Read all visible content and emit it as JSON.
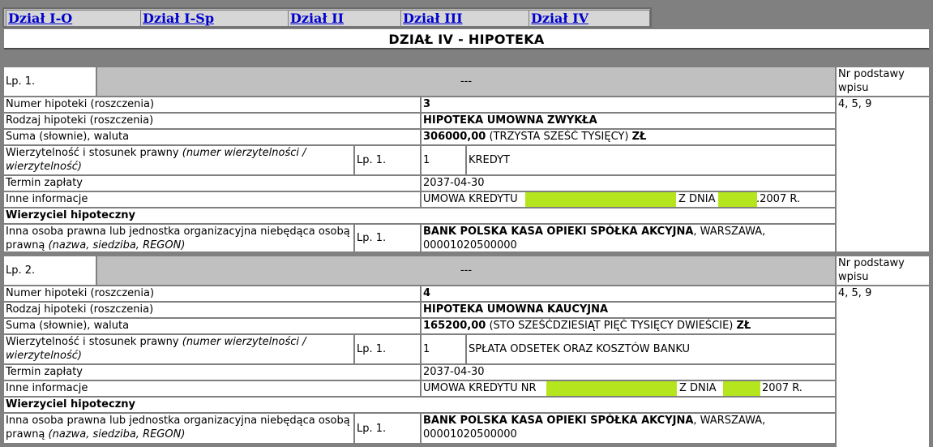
{
  "tabs": [
    "Dział I-O",
    "Dział I-Sp",
    "Dział II",
    "Dział III",
    "Dział IV"
  ],
  "title": "DZIAŁ IV - HIPOTEKA",
  "basis_header": "Nr podstawy wpisu",
  "entries": [
    {
      "lp": "Lp. 1.",
      "dashes": "---",
      "basis": "4, 5, 9",
      "numer_label": "Numer hipoteki (roszczenia)",
      "numer": "3",
      "rodzaj_label": "Rodzaj hipoteki (roszczenia)",
      "rodzaj": "HIPOTEKA UMOWNA ZWYKŁA",
      "suma_label": "Suma (słownie), waluta",
      "suma_amount": "306000,00",
      "suma_words": "(TRZYSTA SZEŚĆ TYSIĘCY)",
      "suma_currency": "ZŁ",
      "wierz_label": "Wierzytelność i stosunek prawny",
      "wierz_label_italic": "(numer wierzytelności / wierzytelność)",
      "wierz_lp": "Lp. 1.",
      "wierz_no": "1",
      "wierz_name": "KREDYT",
      "termin_label": "Termin zapłaty",
      "termin": "2037-04-30",
      "inne_label": "Inne informacje",
      "inne_a": "UMOWA KREDYTU",
      "inne_b": "Z DNIA",
      "inne_c": ".2007 R.",
      "wierzyciel_header": "Wierzyciel hipoteczny",
      "osoba_label": "Inna osoba prawna lub jednostka organizacyjna niebędąca osobą prawną",
      "osoba_label_italic": "(nazwa, siedziba, REGON)",
      "osoba_lp": "Lp. 1.",
      "bank_name": "BANK POLSKA KASA OPIEKI SPÓŁKA AKCYJNA",
      "bank_city": ", WARSZAWA,",
      "bank_regon": "00001020500000"
    },
    {
      "lp": "Lp. 2.",
      "dashes": "---",
      "basis": "4, 5, 9",
      "numer_label": "Numer hipoteki (roszczenia)",
      "numer": "4",
      "rodzaj_label": "Rodzaj hipoteki (roszczenia)",
      "rodzaj": "HIPOTEKA UMOWNA KAUCYJNA",
      "suma_label": "Suma (słownie), waluta",
      "suma_amount": "165200,00",
      "suma_words": "(STO SZEŚĆDZIESIĄT PIĘĆ TYSIĘCY DWIEŚCIE)",
      "suma_currency": "ZŁ",
      "wierz_label": "Wierzytelność i stosunek prawny",
      "wierz_label_italic": "(numer wierzytelności / wierzytelność)",
      "wierz_lp": "Lp. 1.",
      "wierz_no": "1",
      "wierz_name": "SPŁATA ODSETEK ORAZ KOSZTÓW BANKU",
      "termin_label": "Termin zapłaty",
      "termin": "2037-04-30",
      "inne_label": "Inne informacje",
      "inne_a": "UMOWA KREDYTU NR",
      "inne_b": "Z DNIA",
      "inne_c": "2007 R.",
      "wierzyciel_header": "Wierzyciel hipoteczny",
      "osoba_label": "Inna osoba prawna lub jednostka organizacyjna niebędąca osobą prawną",
      "osoba_label_italic": "(nazwa, siedziba, REGON)",
      "osoba_lp": "Lp. 1.",
      "bank_name": "BANK POLSKA KASA OPIEKI SPÓŁKA AKCYJNA",
      "bank_city": ", WARSZAWA,",
      "bank_regon": "00001020500000"
    }
  ],
  "colors": {
    "link": "#0000cc",
    "background": "#808080",
    "header_gray": "#c0c0c0",
    "redaction": "#b5e61d"
  }
}
